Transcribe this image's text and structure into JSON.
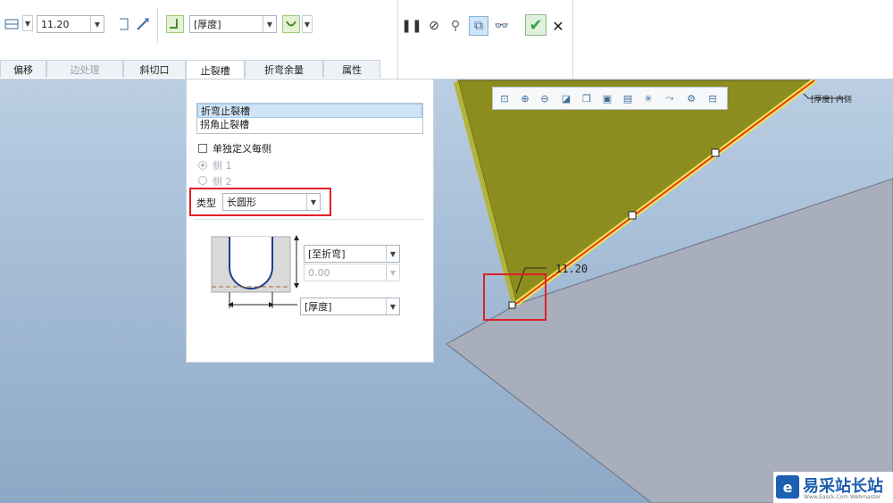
{
  "toolbar": {
    "width_value": "11.20",
    "thickness_combo": "[厚度]",
    "pause_icon": "pause-icon",
    "colors": {
      "check": "#2ea84a",
      "accent": "#4a6d8f"
    }
  },
  "tabs": [
    {
      "label": "偏移",
      "state": "normal"
    },
    {
      "label": "边处理",
      "state": "disabled"
    },
    {
      "label": "斜切口",
      "state": "normal"
    },
    {
      "label": "止裂槽",
      "state": "active"
    },
    {
      "label": "折弯余量",
      "state": "normal"
    },
    {
      "label": "属性",
      "state": "normal"
    }
  ],
  "panel": {
    "list_items": [
      "折弯止裂槽",
      "拐角止裂槽"
    ],
    "checkbox_label": "单独定义每侧",
    "side1": "侧 1",
    "side2": "侧 2",
    "type_label": "类型",
    "type_value": "长圆形",
    "depth_combo": "[至折弯]",
    "depth_value": "0.00",
    "width_combo": "[厚度]"
  },
  "viewport": {
    "dimension_label": "11.20",
    "edge_label": "[厚度] 内侧"
  },
  "watermark": {
    "title": "易采站长站",
    "subtitle": "Www.Easck.Com Webmaster"
  }
}
